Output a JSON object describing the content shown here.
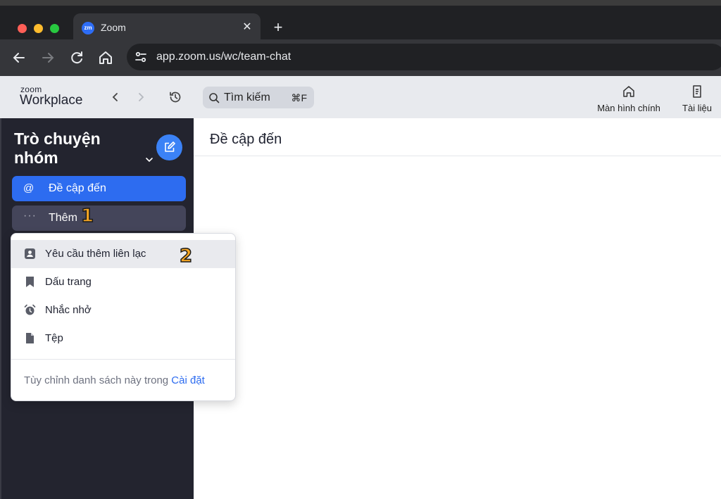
{
  "browser": {
    "tab_title": "Zoom",
    "tab_favicon_text": "zm",
    "url": "app.zoom.us/wc/team-chat"
  },
  "header": {
    "logo_small": "zoom",
    "logo_big": "Workplace",
    "search_placeholder": "Tìm kiếm",
    "search_shortcut": "⌘F",
    "home_label": "Màn hình chính",
    "docs_label": "Tài liệu"
  },
  "sidebar": {
    "title": "Trò chuyện nhóm",
    "items": [
      {
        "icon": "@",
        "label": "Đề cập đến"
      },
      {
        "icon": "···",
        "label": "Thêm"
      }
    ]
  },
  "main": {
    "title": "Đề cập đến"
  },
  "dropdown": {
    "items": [
      {
        "icon": "contact-icon",
        "label": "Yêu cầu thêm liên lạc"
      },
      {
        "icon": "bookmark-icon",
        "label": "Dấu trang"
      },
      {
        "icon": "alarm-icon",
        "label": "Nhắc nhở"
      },
      {
        "icon": "file-icon",
        "label": "Tệp"
      }
    ],
    "footer_text": "Tùy chỉnh danh sách này trong ",
    "footer_link": "Cài đặt"
  },
  "markers": {
    "one": "1",
    "two": "2"
  },
  "colors": {
    "accent": "#2d6cf0",
    "sidebar_bg": "#23242f",
    "marker": "#f6a623"
  }
}
